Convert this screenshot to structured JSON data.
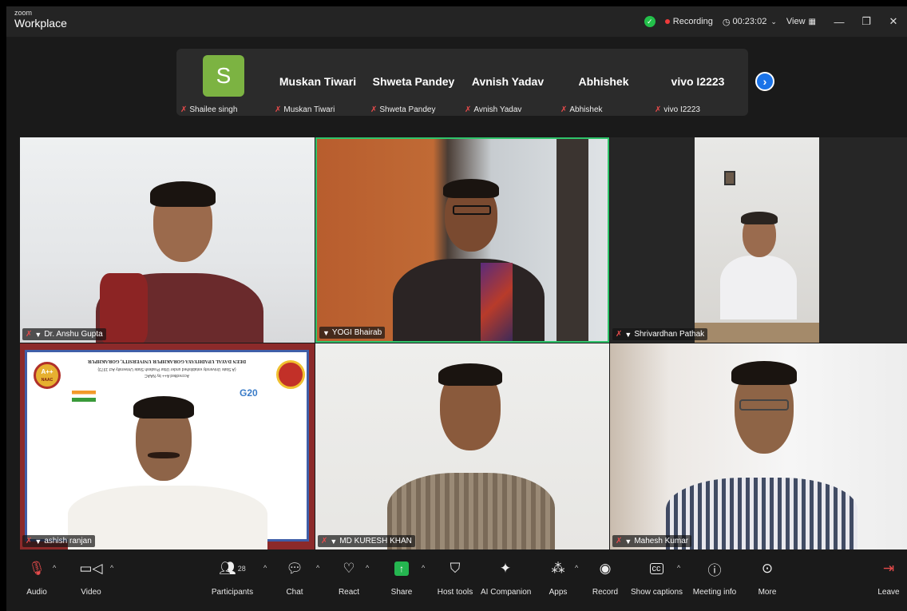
{
  "app": {
    "brand_small": "zoom",
    "brand_name": "Workplace"
  },
  "titlebar": {
    "recording_label": "Recording",
    "timer": "00:23:02",
    "view_label": "View"
  },
  "filmstrip": [
    {
      "label": "Shailee singh",
      "avatar_letter": "S",
      "display_name": ""
    },
    {
      "label": "Muskan Tiwari",
      "display_name": "Muskan Tiwari"
    },
    {
      "label": "Shweta Pandey",
      "display_name": "Shweta Pandey"
    },
    {
      "label": "Avnish Yadav",
      "display_name": "Avnish Yadav"
    },
    {
      "label": "Abhishek",
      "display_name": "Abhishek"
    },
    {
      "label": "vivo I2223",
      "display_name": "vivo I2223"
    }
  ],
  "grid": [
    {
      "name": "Dr. Anshu Gupta"
    },
    {
      "name": "YOGI Bhairab"
    },
    {
      "name": "Shrivardhan Pathak"
    },
    {
      "name": "ashish ranjan"
    },
    {
      "name": "MD KURESH KHAN"
    },
    {
      "name": "Mahesh Kumar"
    }
  ],
  "slide": {
    "title": "DEEN DAYAL UPADHYAYA GORAKHPUR UNIVERSITY, GORAKHPUR",
    "sub1": "(A State University established under Uttar Pradesh State University Act 1973)",
    "sub2": "Accredited A++ by NAAC",
    "naac_grade": "A++",
    "naac_text": "NAAC",
    "g20": "G20"
  },
  "toolbar": {
    "audio": "Audio",
    "video": "Video",
    "participants": "Participants",
    "participants_count": "28",
    "chat": "Chat",
    "react": "React",
    "share": "Share",
    "host_tools": "Host tools",
    "ai_companion": "AI Companion",
    "apps": "Apps",
    "record": "Record",
    "show_captions": "Show captions",
    "meeting_info": "Meeting info",
    "more": "More",
    "leave": "Leave"
  },
  "colors": {
    "share_green": "#25b650",
    "active_speaker": "#2fc46b",
    "recording_red": "#ef3b3b",
    "next_blue": "#1a73e8"
  }
}
